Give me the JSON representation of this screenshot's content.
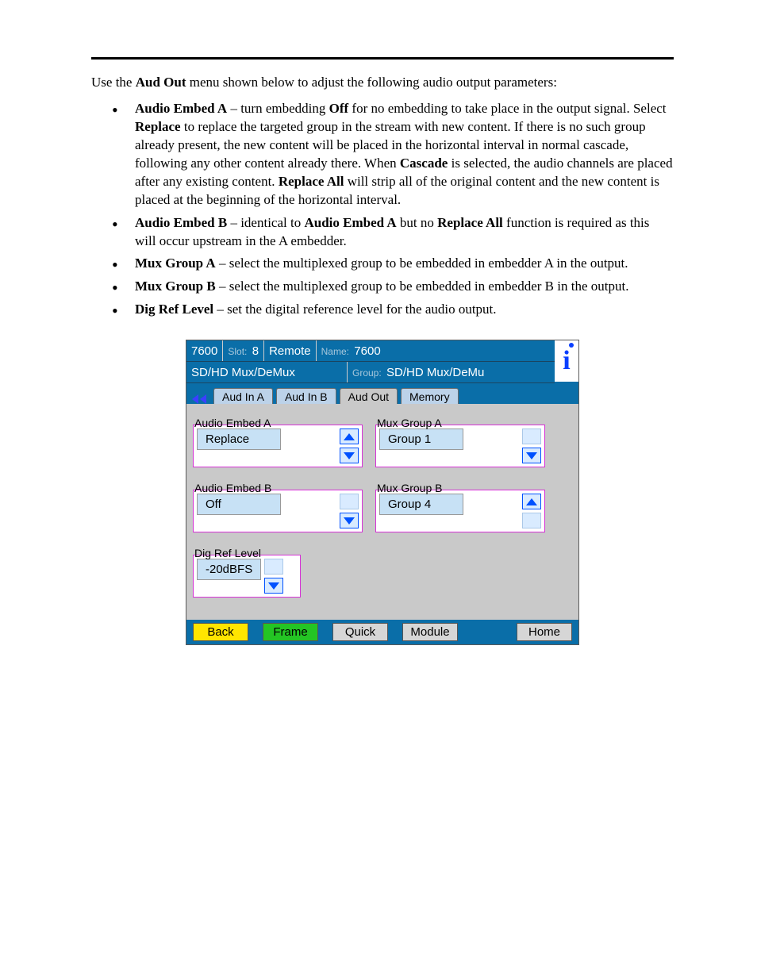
{
  "intro": {
    "prefix": "Use the ",
    "menu": "Aud Out",
    "suffix": " menu shown below to adjust the following audio output parameters:"
  },
  "bullets": [
    {
      "term": "Audio Embed A",
      "a": " – turn embedding ",
      "k1": "Off",
      "b": " for no embedding to take place in the output signal. Select ",
      "k2": "Replace",
      "c": " to replace the targeted group in the stream with new content. If there is no such group already present, the new content will be placed in the horizontal interval in normal cascade, following any other content already there. When ",
      "k3": "Cascade",
      "d": " is selected, the audio channels are placed after any existing content. ",
      "k4": "Replace All",
      "e": " will strip all of the original content and the new content is placed at the beginning of the horizontal interval."
    },
    {
      "term": "Audio Embed B",
      "a": " – identical to ",
      "k1": "Audio Embed A",
      "b": " but no ",
      "k2": "Replace All",
      "c": " function is required as this will occur upstream in the A embedder."
    },
    {
      "term": "Mux Group A",
      "a": " – select the multiplexed group to be embedded in embedder A in the output."
    },
    {
      "term": "Mux Group B",
      "a": " – select the multiplexed group to be embedded in embedder B in the output."
    },
    {
      "term": "Dig Ref Level",
      "a": " – set the digital reference level for the audio output."
    }
  ],
  "device": {
    "header": {
      "id": "7600",
      "slot_label": "Slot: ",
      "slot": "8",
      "remote": "Remote",
      "name_label": "Name: ",
      "name": "7600",
      "module": "SD/HD Mux/DeMux",
      "group_label": "Group: ",
      "group": "SD/HD Mux/DeMu"
    },
    "tabs": [
      "Aud In A",
      "Aud In B",
      "Aud Out",
      "Memory"
    ],
    "fields": {
      "embed_a": {
        "label": "Audio Embed A",
        "value": "Replace"
      },
      "mux_a": {
        "label": "Mux Group A",
        "value": "Group 1"
      },
      "embed_b": {
        "label": "Audio Embed B",
        "value": "Off"
      },
      "mux_b": {
        "label": "Mux Group B",
        "value": "Group 4"
      },
      "dig_ref": {
        "label": "Dig Ref Level",
        "value": "-20dBFS"
      }
    },
    "footer": {
      "back": "Back",
      "frame": "Frame",
      "quick": "Quick",
      "module": "Module",
      "home": "Home"
    }
  }
}
